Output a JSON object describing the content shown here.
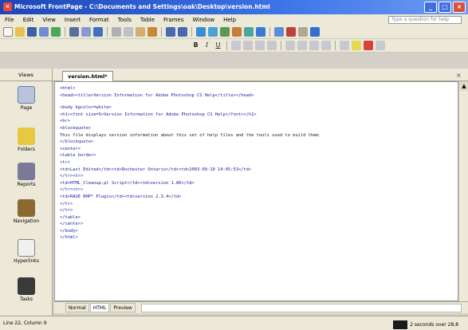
{
  "window": {
    "title": "Microsoft FrontPage - C:\\Documents and Settings\\oak\\Desktop\\version.html",
    "controls": [
      "_",
      "□",
      "×"
    ]
  },
  "menu": {
    "items": [
      "File",
      "Edit",
      "View",
      "Insert",
      "Format",
      "Tools",
      "Table",
      "Frames",
      "Window",
      "Help"
    ],
    "help_placeholder": "Type a question for help"
  },
  "views": {
    "header": "Views",
    "items": [
      "Page",
      "Folders",
      "Reports",
      "Navigation",
      "Hyperlinks",
      "Tasks"
    ]
  },
  "document": {
    "tab_label": "version.html*",
    "lines": [
      "<html>",
      "<head><title>Version Information for Adobe Photoshop CS Help</title></head>",
      "",
      "<body bgcolor=white>",
      "<h1><font size=5>Version Information for Adobe Photoshop CS Help</font></h1>",
      "<hr>",
      "<blockquote>",
      "This file displays version information about this set of help files and the tools used to build them.",
      "</blockquote>",
      "<center>",
      "<table border>",
      "<tr>",
      "<td>Last Edited</td><td>Rochester Ontario</td><td>2003-09-10 14:45:53</td>",
      "</tr><tr>",
      "<td>HTML_Cleanup.pl Script</td><td>version 1.86</td>",
      "</tr><tr>",
      "<td>RAGE RHP* Plugin</td><td>version 2.3.4</td>",
      "</tr>",
      "</tr>",
      "</table>",
      "</center>",
      "</body>",
      "</html>",
      ""
    ]
  },
  "mode_tabs": [
    "Normal",
    "HTML",
    "Preview"
  ],
  "status": {
    "left": "Line 22, Column 9",
    "right": "2 seconds over 28.8"
  }
}
